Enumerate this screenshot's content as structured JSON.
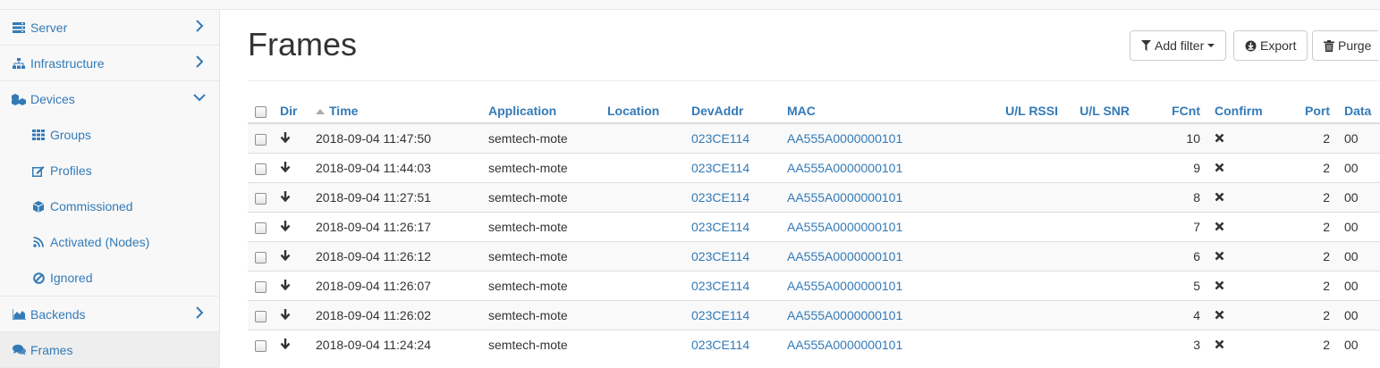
{
  "sidebar": {
    "items": [
      {
        "label": "Server",
        "icon": "server-icon",
        "chevron": "right"
      },
      {
        "label": "Infrastructure",
        "icon": "sitemap-icon",
        "chevron": "right"
      },
      {
        "label": "Devices",
        "icon": "cubes-icon",
        "chevron": "down"
      },
      {
        "label": "Groups",
        "icon": "grid-icon"
      },
      {
        "label": "Profiles",
        "icon": "edit-icon"
      },
      {
        "label": "Commissioned",
        "icon": "cube-icon"
      },
      {
        "label": "Activated (Nodes)",
        "icon": "rss-icon"
      },
      {
        "label": "Ignored",
        "icon": "ban-icon"
      },
      {
        "label": "Backends",
        "icon": "area-chart-icon",
        "chevron": "right"
      },
      {
        "label": "Frames",
        "icon": "comments-icon"
      }
    ]
  },
  "main": {
    "title": "Frames",
    "buttons": {
      "add_filter": "Add filter",
      "export": "Export",
      "purge": "Purge"
    }
  },
  "table": {
    "columns": [
      "Dir",
      "Time",
      "Application",
      "Location",
      "DevAddr",
      "MAC",
      "U/L RSSI",
      "U/L SNR",
      "FCnt",
      "Confirm",
      "Port",
      "Data"
    ],
    "rows": [
      {
        "dir": "down-arrow",
        "time": "2018-09-04 11:47:50",
        "application": "semtech-mote",
        "location": "",
        "devaddr": "023CE114",
        "mac": "AA555A0000000101",
        "rssi": "",
        "snr": "",
        "fcnt": "10",
        "confirm": "times-icon",
        "port": "2",
        "data": "00"
      },
      {
        "dir": "down-arrow",
        "time": "2018-09-04 11:44:03",
        "application": "semtech-mote",
        "location": "",
        "devaddr": "023CE114",
        "mac": "AA555A0000000101",
        "rssi": "",
        "snr": "",
        "fcnt": "9",
        "confirm": "times-icon",
        "port": "2",
        "data": "00"
      },
      {
        "dir": "down-arrow",
        "time": "2018-09-04 11:27:51",
        "application": "semtech-mote",
        "location": "",
        "devaddr": "023CE114",
        "mac": "AA555A0000000101",
        "rssi": "",
        "snr": "",
        "fcnt": "8",
        "confirm": "times-icon",
        "port": "2",
        "data": "00"
      },
      {
        "dir": "down-arrow",
        "time": "2018-09-04 11:26:17",
        "application": "semtech-mote",
        "location": "",
        "devaddr": "023CE114",
        "mac": "AA555A0000000101",
        "rssi": "",
        "snr": "",
        "fcnt": "7",
        "confirm": "times-icon",
        "port": "2",
        "data": "00"
      },
      {
        "dir": "down-arrow",
        "time": "2018-09-04 11:26:12",
        "application": "semtech-mote",
        "location": "",
        "devaddr": "023CE114",
        "mac": "AA555A0000000101",
        "rssi": "",
        "snr": "",
        "fcnt": "6",
        "confirm": "times-icon",
        "port": "2",
        "data": "00"
      },
      {
        "dir": "down-arrow",
        "time": "2018-09-04 11:26:07",
        "application": "semtech-mote",
        "location": "",
        "devaddr": "023CE114",
        "mac": "AA555A0000000101",
        "rssi": "",
        "snr": "",
        "fcnt": "5",
        "confirm": "times-icon",
        "port": "2",
        "data": "00"
      },
      {
        "dir": "down-arrow",
        "time": "2018-09-04 11:26:02",
        "application": "semtech-mote",
        "location": "",
        "devaddr": "023CE114",
        "mac": "AA555A0000000101",
        "rssi": "",
        "snr": "",
        "fcnt": "4",
        "confirm": "times-icon",
        "port": "2",
        "data": "00"
      },
      {
        "dir": "down-arrow",
        "time": "2018-09-04 11:24:24",
        "application": "semtech-mote",
        "location": "",
        "devaddr": "023CE114",
        "mac": "AA555A0000000101",
        "rssi": "",
        "snr": "",
        "fcnt": "3",
        "confirm": "times-icon",
        "port": "2",
        "data": "00"
      }
    ]
  },
  "colors": {
    "link": "#337ab7",
    "sidebar_bg": "#f8f8f8",
    "active_bg": "#eeeeee"
  }
}
